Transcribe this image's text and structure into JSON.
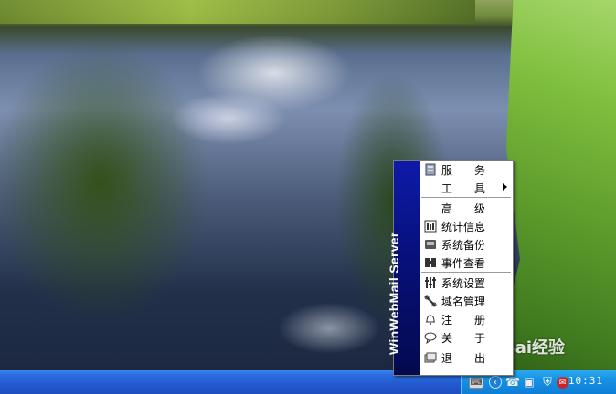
{
  "desktop": {
    "watermark_text": "Bai经验"
  },
  "tray": {
    "clock": "10:31",
    "icons": [
      "keyboard-icon",
      "show-hidden-icon",
      "phone-icon",
      "monitor-icon",
      "shield-icon",
      "server-tray-icon"
    ]
  },
  "context_menu": {
    "side_title": "WinWebMail Server",
    "items": [
      {
        "name": "server",
        "chars": [
          "服",
          "务"
        ],
        "icon": "server-icon"
      },
      {
        "name": "tools",
        "chars": [
          "工",
          "具"
        ],
        "icon": "",
        "submenu": true
      },
      {
        "name": "advanced",
        "chars": [
          "高",
          "级"
        ],
        "icon": ""
      },
      {
        "name": "statistics",
        "label": "统计信息",
        "icon": "stats-icon"
      },
      {
        "name": "system-backup",
        "label": "系统备份",
        "icon": "backup-icon"
      },
      {
        "name": "event-viewer",
        "label": "事件查看",
        "icon": "event-icon"
      },
      {
        "name": "system-settings",
        "label": "系统设置",
        "icon": "settings-icon"
      },
      {
        "name": "domain-management",
        "label": "域名管理",
        "icon": "domain-icon"
      },
      {
        "name": "register",
        "chars": [
          "注",
          "册"
        ],
        "icon": "bell-icon"
      },
      {
        "name": "about",
        "chars": [
          "关",
          "于"
        ],
        "icon": "speech-bubble-icon"
      },
      {
        "name": "exit",
        "chars": [
          "退",
          "出"
        ],
        "icon": "exit-icon"
      }
    ]
  }
}
